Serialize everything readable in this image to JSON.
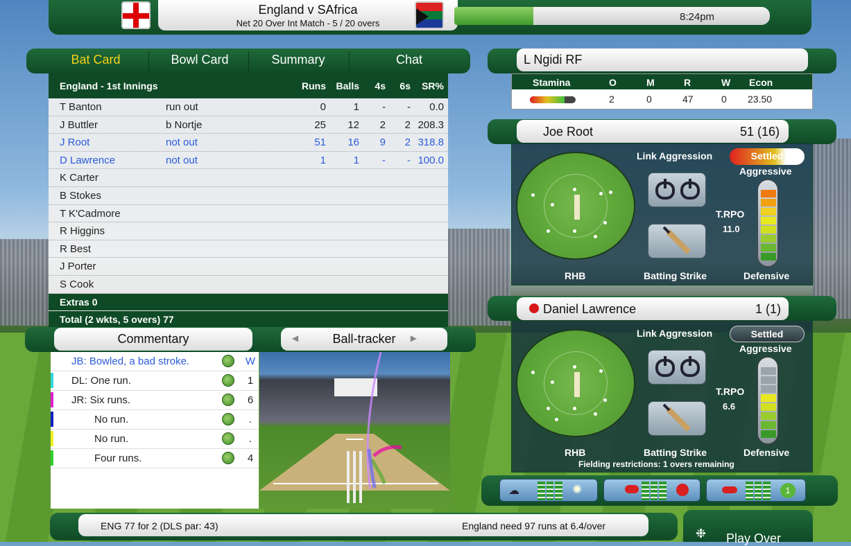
{
  "header": {
    "match_title": "England v SAfrica",
    "match_subtitle": "Net 20 Over Int Match - 5 / 20 overs",
    "progress": 0.25,
    "time": "8:24pm"
  },
  "scorecard": {
    "tabs": [
      "Bat Card",
      "Bowl Card",
      "Summary",
      "Chat"
    ],
    "active_tab": "Bat Card",
    "innings_title": "England - 1st Innings",
    "columns": [
      "Runs",
      "Balls",
      "4s",
      "6s",
      "SR%"
    ],
    "batters": [
      {
        "name": "T Banton",
        "how_out": "run out",
        "runs": "0",
        "balls": "1",
        "fours": "-",
        "sixes": "-",
        "sr": "0.0",
        "highlight": false
      },
      {
        "name": "J Buttler",
        "how_out": "b Nortje",
        "runs": "25",
        "balls": "12",
        "fours": "2",
        "sixes": "2",
        "sr": "208.3",
        "highlight": false
      },
      {
        "name": "J Root",
        "how_out": "not out",
        "runs": "51",
        "balls": "16",
        "fours": "9",
        "sixes": "2",
        "sr": "318.8",
        "highlight": true
      },
      {
        "name": "D Lawrence",
        "how_out": "not out",
        "runs": "1",
        "balls": "1",
        "fours": "-",
        "sixes": "-",
        "sr": "100.0",
        "highlight": true
      },
      {
        "name": "K Carter",
        "how_out": "",
        "runs": "",
        "balls": "",
        "fours": "",
        "sixes": "",
        "sr": "",
        "highlight": false
      },
      {
        "name": "B Stokes",
        "how_out": "",
        "runs": "",
        "balls": "",
        "fours": "",
        "sixes": "",
        "sr": "",
        "highlight": false
      },
      {
        "name": "T K'Cadmore",
        "how_out": "",
        "runs": "",
        "balls": "",
        "fours": "",
        "sixes": "",
        "sr": "",
        "highlight": false
      },
      {
        "name": "R Higgins",
        "how_out": "",
        "runs": "",
        "balls": "",
        "fours": "",
        "sixes": "",
        "sr": "",
        "highlight": false
      },
      {
        "name": "R Best",
        "how_out": "",
        "runs": "",
        "balls": "",
        "fours": "",
        "sixes": "",
        "sr": "",
        "highlight": false
      },
      {
        "name": "J Porter",
        "how_out": "",
        "runs": "",
        "balls": "",
        "fours": "",
        "sixes": "",
        "sr": "",
        "highlight": false
      },
      {
        "name": "S Cook",
        "how_out": "",
        "runs": "",
        "balls": "",
        "fours": "",
        "sixes": "",
        "sr": "",
        "highlight": false
      }
    ],
    "extras": "Extras  0",
    "total": "Total (2 wkts, 5 overs) 77"
  },
  "commentary": {
    "tab_label": "Commentary",
    "tracker_label": "Ball-tracker",
    "entries": [
      {
        "text": "JB:  Bowled, a bad stroke.",
        "result": "W",
        "mark_color": "#ffffff",
        "blue": true
      },
      {
        "text": "DL:  One run.",
        "result": "1",
        "mark_color": "#33d6e0",
        "blue": false
      },
      {
        "text": "JR:  Six runs.",
        "result": "6",
        "mark_color": "#e020d0",
        "blue": false
      },
      {
        "text": "No run.",
        "result": ".",
        "mark_color": "#1020c0",
        "blue": false
      },
      {
        "text": "No run.",
        "result": ".",
        "mark_color": "#f0f020",
        "blue": false
      },
      {
        "text": "Four runs.",
        "result": "4",
        "mark_color": "#30d030",
        "blue": false
      }
    ]
  },
  "bowler": {
    "name": "L Ngidi RF",
    "stat_headers": [
      "Stamina",
      "O",
      "M",
      "R",
      "W",
      "Econ"
    ],
    "overs": "2",
    "maidens": "0",
    "runs": "47",
    "wickets": "0",
    "econ": "23.50",
    "stamina": 0.75
  },
  "batsman1": {
    "name": "Joe Root",
    "score": "51 (16)",
    "link_label": "Link Aggression",
    "mode": "Settled",
    "aggressive_label": "Aggressive",
    "defensive_label": "Defensive",
    "trpo_label": "T.RPO",
    "trpo": "11.0",
    "hand": "RHB",
    "strike_label": "Batting Strike"
  },
  "batsman2": {
    "name": "Daniel Lawrence",
    "score": "1 (1)",
    "link_label": "Link Aggression",
    "mode": "Settled",
    "aggressive_label": "Aggressive",
    "defensive_label": "Defensive",
    "trpo_label": "T.RPO",
    "trpo": "6.6",
    "hand": "RHB",
    "strike_label": "Batting Strike",
    "fielding_note": "Fielding restrictions: 1 overs remaining"
  },
  "footer": {
    "score_line": "ENG  77 for 2 (DLS par: 43)",
    "target_line": "England need 97 runs at 6.4/over",
    "play_over": "Play Over"
  },
  "colors": {
    "panel_green": "#0f4a26",
    "highlight_blue": "#2b5bd8",
    "active_tab": "#f3d21a"
  }
}
